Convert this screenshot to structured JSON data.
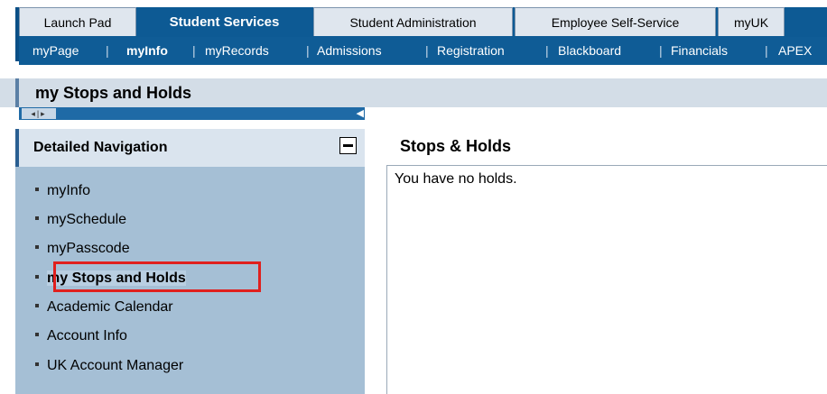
{
  "top_tabs": [
    {
      "label": "Launch Pad",
      "active": false
    },
    {
      "label": "Student Services",
      "active": true
    },
    {
      "label": "Student Administration",
      "active": false
    },
    {
      "label": "Employee Self-Service",
      "active": false
    },
    {
      "label": "myUK",
      "active": false
    }
  ],
  "sub_nav": {
    "items": [
      "myPage",
      "myInfo",
      "myRecords",
      "Admissions",
      "Registration",
      "Blackboard",
      "Financials",
      "APEX"
    ],
    "current": "myInfo",
    "separator": "|"
  },
  "page_title": "my Stops and Holds",
  "splitter": {
    "arrows": "◂|▸",
    "collapse_arrow": "◀"
  },
  "detailed_navigation": {
    "header": "Detailed Navigation",
    "items": [
      {
        "label": "myInfo",
        "selected": false
      },
      {
        "label": "mySchedule",
        "selected": false
      },
      {
        "label": "myPasscode",
        "selected": false
      },
      {
        "label": "my Stops and Holds",
        "selected": true
      },
      {
        "label": "Academic Calendar",
        "selected": false
      },
      {
        "label": "Account Info",
        "selected": false
      },
      {
        "label": "UK Account Manager",
        "selected": false
      }
    ]
  },
  "content": {
    "heading": "Stops & Holds",
    "message": "You have no holds."
  },
  "colors": {
    "nav_blue": "#0d5a94",
    "panel_blue": "#a5bfd5",
    "highlight_red": "#e0201e"
  },
  "icons": {
    "collapse_button": "minus-icon",
    "splitter_arrows": "arrow-left-right-icon",
    "collapse_arrow": "triangle-left-icon"
  }
}
